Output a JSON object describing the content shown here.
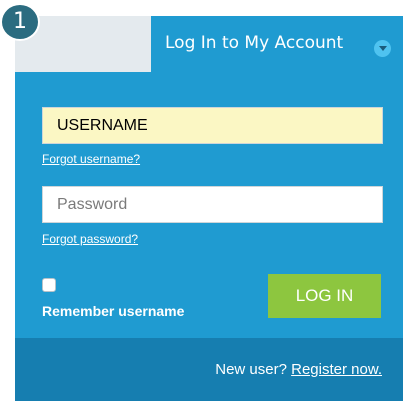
{
  "step_badge": "1",
  "header": {
    "title": "Log In to My Account",
    "dropdown_icon": "chevron-down-icon"
  },
  "username": {
    "value": "USERNAME"
  },
  "links": {
    "forgot_username": "Forgot username?",
    "forgot_password": "Forgot password?"
  },
  "password": {
    "placeholder": "Password",
    "value": ""
  },
  "remember": {
    "label": "Remember username",
    "checked": false
  },
  "login_button": {
    "label": "LOG IN"
  },
  "footer": {
    "prompt": "New user?",
    "register_label": "Register now."
  },
  "colors": {
    "panel": "#1f9bd1",
    "footer": "#167eb0",
    "button": "#8dc63f",
    "username_field": "#fbf7c4",
    "badge": "#2b6c80"
  }
}
